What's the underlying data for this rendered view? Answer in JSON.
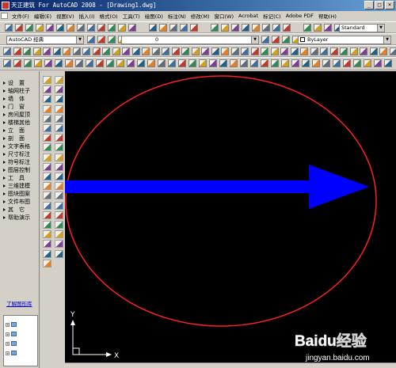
{
  "window": {
    "title": "天正建筑 For AutoCAD 2008 - [Drawing1.dwg]",
    "buttons": [
      "_",
      "□",
      "×"
    ]
  },
  "menubar": {
    "items": [
      "文件(F)",
      "编辑(E)",
      "视图(V)",
      "插入(I)",
      "格式(O)",
      "工具(T)",
      "绘图(D)",
      "标注(N)",
      "修改(M)",
      "窗口(W)",
      "Acrobat",
      "标记(C)",
      "Adobe PDF",
      "帮助(H)"
    ]
  },
  "toolbar2": {
    "workspace": "AutoCAD 经典",
    "layer": "0",
    "linetype": "ByLayer",
    "textstyle": "Standard"
  },
  "left_panel": {
    "items": [
      "设　置",
      "轴网柱子",
      "墙　体",
      "门　窗",
      "房间屋顶",
      "楼梯其他",
      "立　面",
      "剖　面",
      "文字表格",
      "尺寸标注",
      "符号标注",
      "图层控制",
      "工　具",
      "三维建模",
      "图块图案",
      "文件布图",
      "其　它",
      "帮助演示"
    ],
    "help_link": "了解图形库"
  },
  "canvas": {
    "background": "#000000",
    "ellipse_color": "#ff2020",
    "arrow_color": "#0000ff",
    "ucs_x": "X",
    "ucs_y": "Y"
  },
  "watermark": {
    "brand": "Baidu经验",
    "url": "jingyan.baidu.com"
  }
}
